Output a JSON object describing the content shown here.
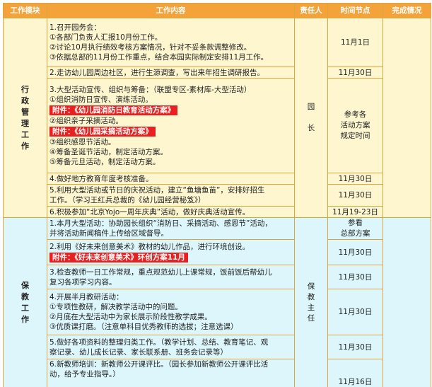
{
  "headers": {
    "module": "工作模块",
    "content": "工作内容",
    "owner": "责任人",
    "time": "时间节点",
    "status": "完成情况"
  },
  "section1": {
    "module_chars": [
      "行",
      "政",
      "管",
      "理",
      "工",
      "作"
    ],
    "owner_chars": [
      "园",
      "长"
    ],
    "rows": [
      {
        "lines": [
          "1.召开园务会：",
          "①各部门负责人汇报10月份工作。",
          "②讨论10月执行绩效考核方案情况，针对不妥条款调整修改。",
          "③依据总部的11月份工作重点，结合本园实际制定安排11月工作。"
        ],
        "time": "11月1日"
      },
      {
        "lines": [
          "2.走访幼儿园周边社区，进行生源调查，写出来年招生调研报告。"
        ],
        "time": "11月30日"
      },
      {
        "lines_a": [
          "3.大型活动宣传、组织与筹备：（联盟专区-素材库-大型活动）",
          "①组织消防日宣传、演练活动。"
        ],
        "attach1_lead": "附件：",
        "attach1_title": "《幼儿园消防日教育活动方案》",
        "lines_b": [
          "②组织亲子采摘活动。"
        ],
        "attach2_lead": "附件：",
        "attach2_title": "《幼儿园采摘活动方案》",
        "lines_c": [
          "③组织感恩节活动。",
          "④筹备圣诞节活动，制定活动方案。",
          "⑤筹备元旦活动，制定活动方案。"
        ],
        "time_lines": [
          "参考各",
          "活动方案",
          "规定时间"
        ]
      },
      {
        "lines": [
          "4.做好地方教育年度考核准备。"
        ],
        "time": "11月30日"
      },
      {
        "lines": [
          "5.利用大型活动或节日的庆祝活动，建立“鱼塘鱼苗”，安排好招生",
          "工作。（学习王红兵总裁的《幼儿园经营秘笈》）"
        ],
        "time": "11月30日"
      },
      {
        "lines": [
          "6.积极参加“北京Yojo一周年庆典”活动，做好庆典活动宣传。"
        ],
        "time": "11月19-23日"
      }
    ]
  },
  "section2": {
    "module_chars": [
      "保",
      "教",
      "工",
      "作"
    ],
    "owner_chars": [
      "保",
      "教",
      "主",
      "任"
    ],
    "rows": [
      {
        "lines": [
          "1.本月大型活动：协助园长组织“消防日、采摘活动、感恩节”活动，",
          "并将活动新闻稿件上传给区域督导。"
        ],
        "time_lines": [
          "参看",
          "总部方案"
        ]
      },
      {
        "lines": [
          "2.利用《好未来创意美术》教材的幼儿作品，进行环境创设。"
        ],
        "attach_lead": "附件：",
        "attach_title": "《好未来创意美术》环创方案11月",
        "time": "11月30日"
      },
      {
        "lines": [
          "3.检查教师一日工作常规，重点规范幼儿上课常规，饭前饭后帮幼儿",
          "复习各项学习内容。"
        ],
        "time": "11月30日"
      },
      {
        "lines": [
          "4.开展半月教研活动：",
          "①专项性教研，解决教学活动中的问题。",
          "②月底在大型活动中为家长展示阶段性教学成果。",
          "③优质课打磨。（注意单科目优秀教师的选拔；注意选课）"
        ],
        "time": "11月30日"
      },
      {
        "lines": [
          "5.做好各项资料的整理归类工作。（教学计划、总结、教育笔记、观",
          "察记录、幼儿成长记录、家长联系册、班务会记录等）"
        ],
        "time": "11月30日"
      },
      {
        "lines": [
          "6.新教师培训：新教师公开课评比。（园长参加新教师公开课评比活",
          "动，给予专业指导。）"
        ],
        "time": "11月16日"
      }
    ]
  },
  "colors": {
    "header_bg": "#f4a23a",
    "section1_bg": "#fdf6cf",
    "section2_bg": "#dcf6fb",
    "attachment_bg": "#e8201f",
    "border": "#d9a640"
  }
}
